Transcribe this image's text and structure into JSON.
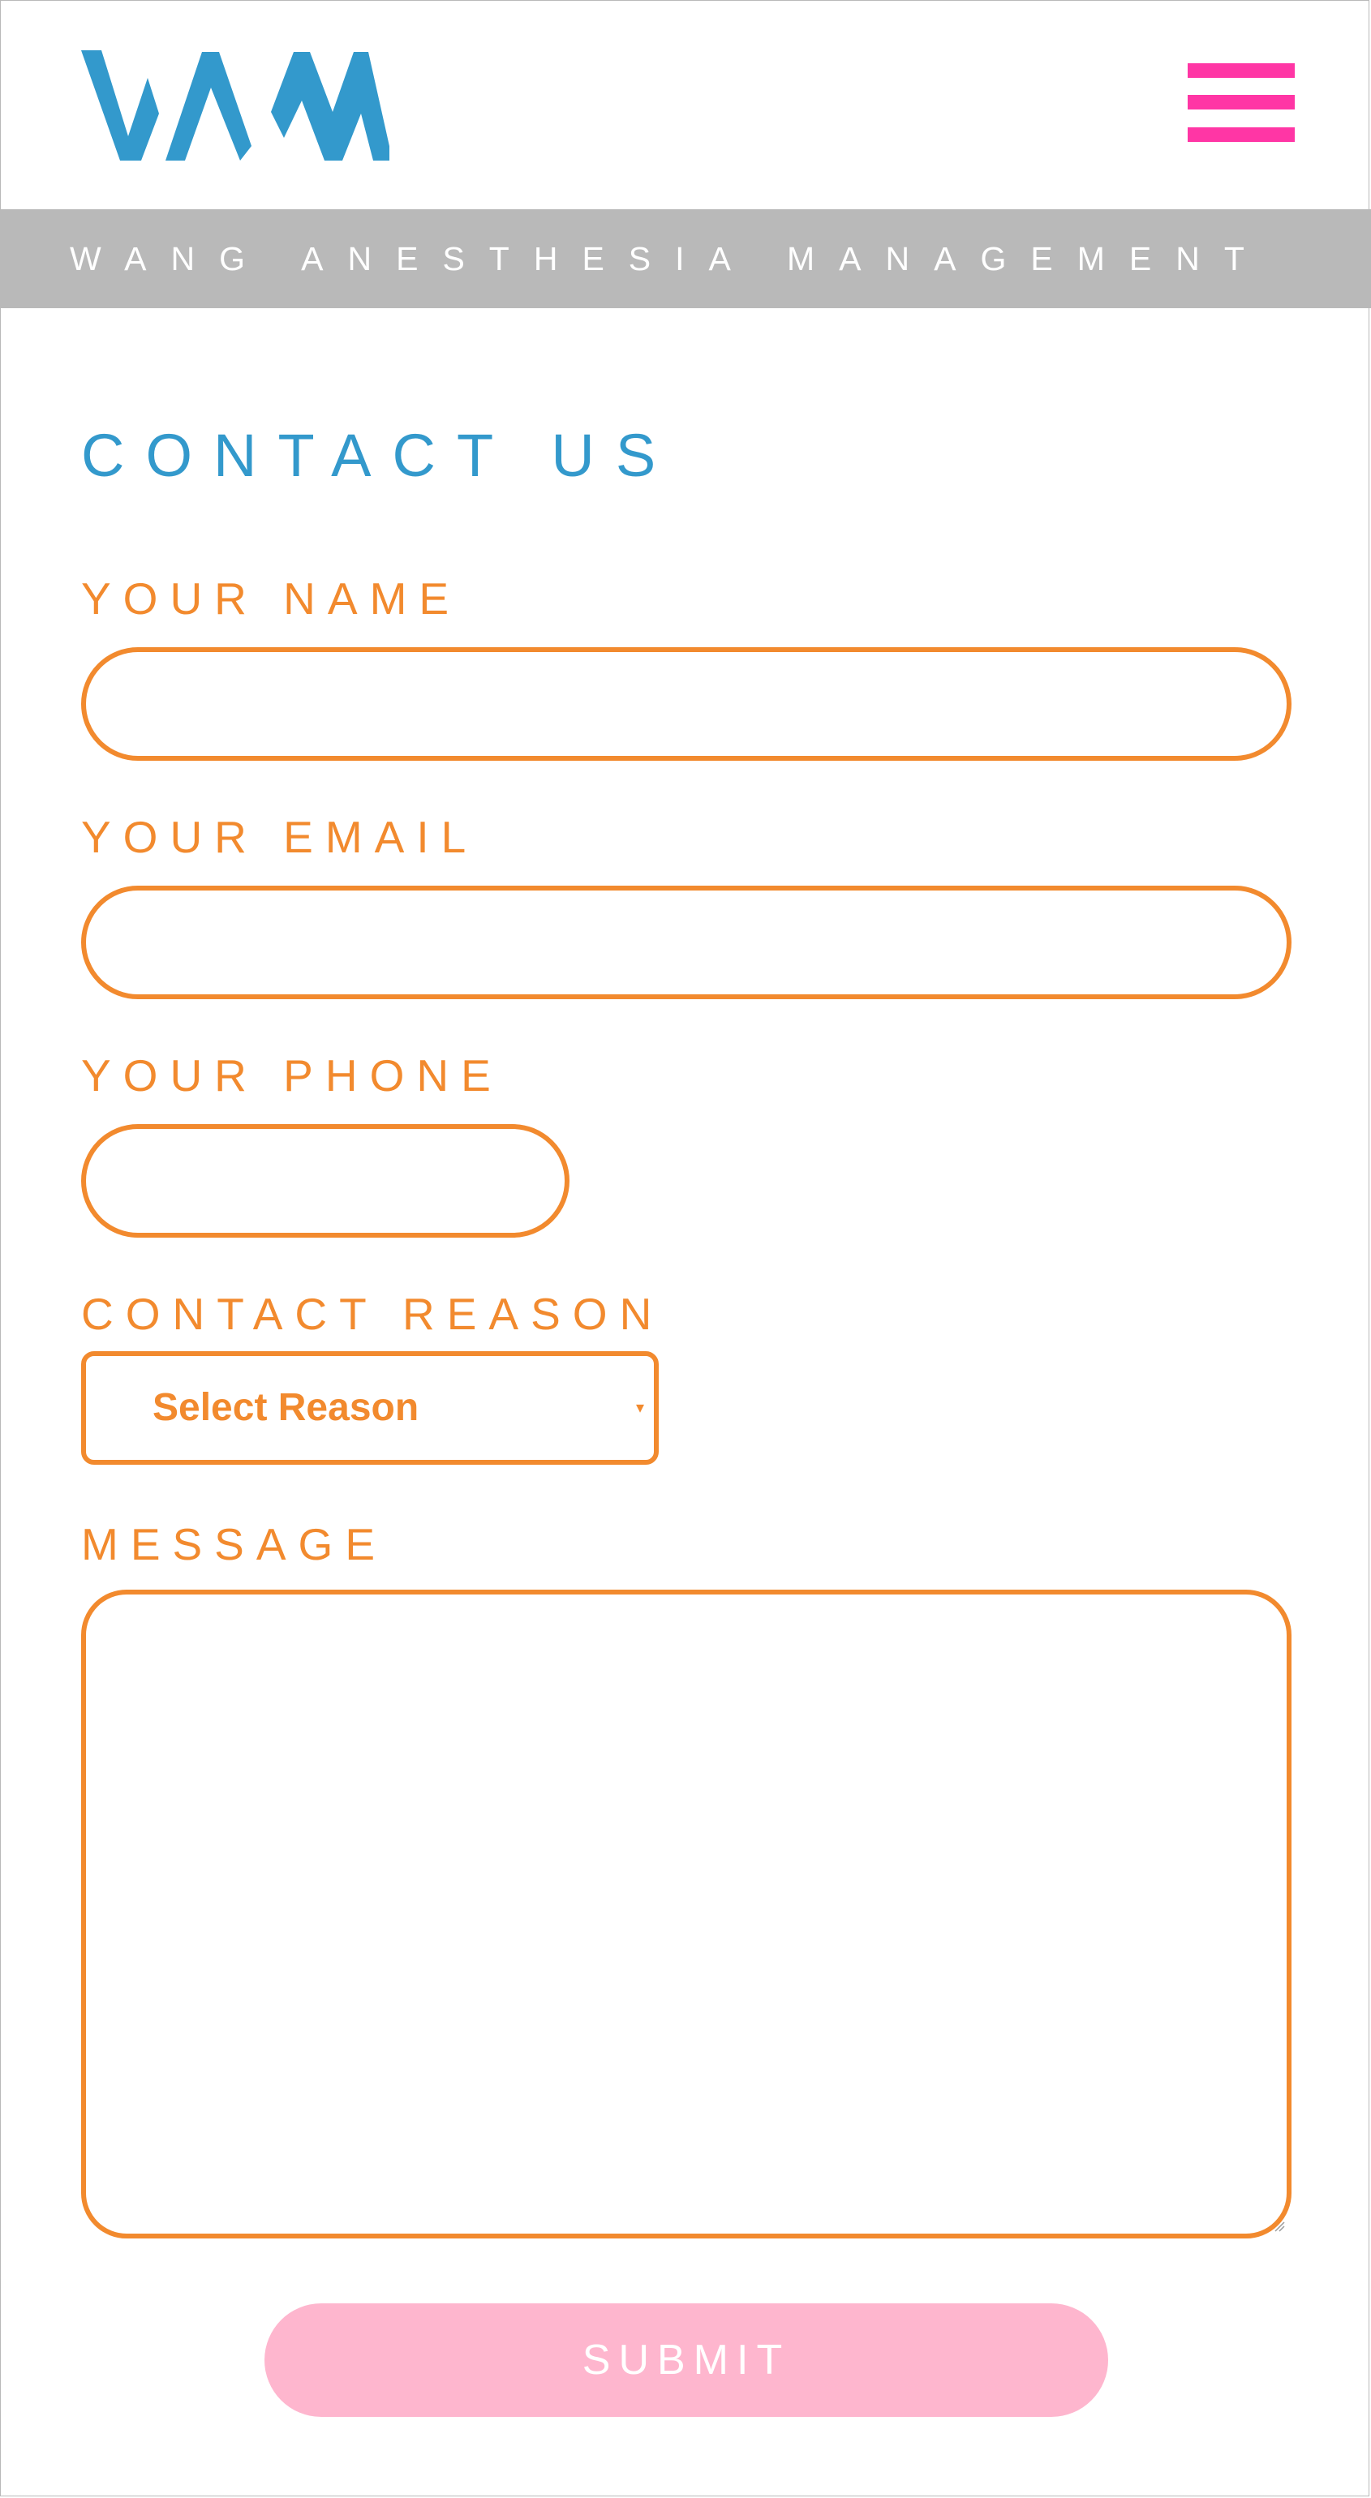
{
  "brand": {
    "logo_text": "WAM",
    "tagline": "WANG ANESTHESIA MANAGEMENT",
    "logo_color": "#3399cc",
    "menu_color": "#ff36a5",
    "menu_icon": "hamburger-icon"
  },
  "form": {
    "title": "CONTACT US",
    "name_label": "YOUR NAME",
    "name_value": "",
    "email_label": "YOUR EMAIL",
    "email_value": "",
    "phone_label": "YOUR PHONE",
    "phone_value": "",
    "reason_label": "CONTACT REASON",
    "reason_selected": "Select Reason",
    "reason_arrow": "▾",
    "message_label": "MESSAGE",
    "message_value": "",
    "submit_label": "SUBMIT",
    "accent_color": "#f28a2e",
    "title_color": "#3399cc",
    "submit_color": "#feb6ce",
    "banner_color": "#b9b9b9"
  }
}
